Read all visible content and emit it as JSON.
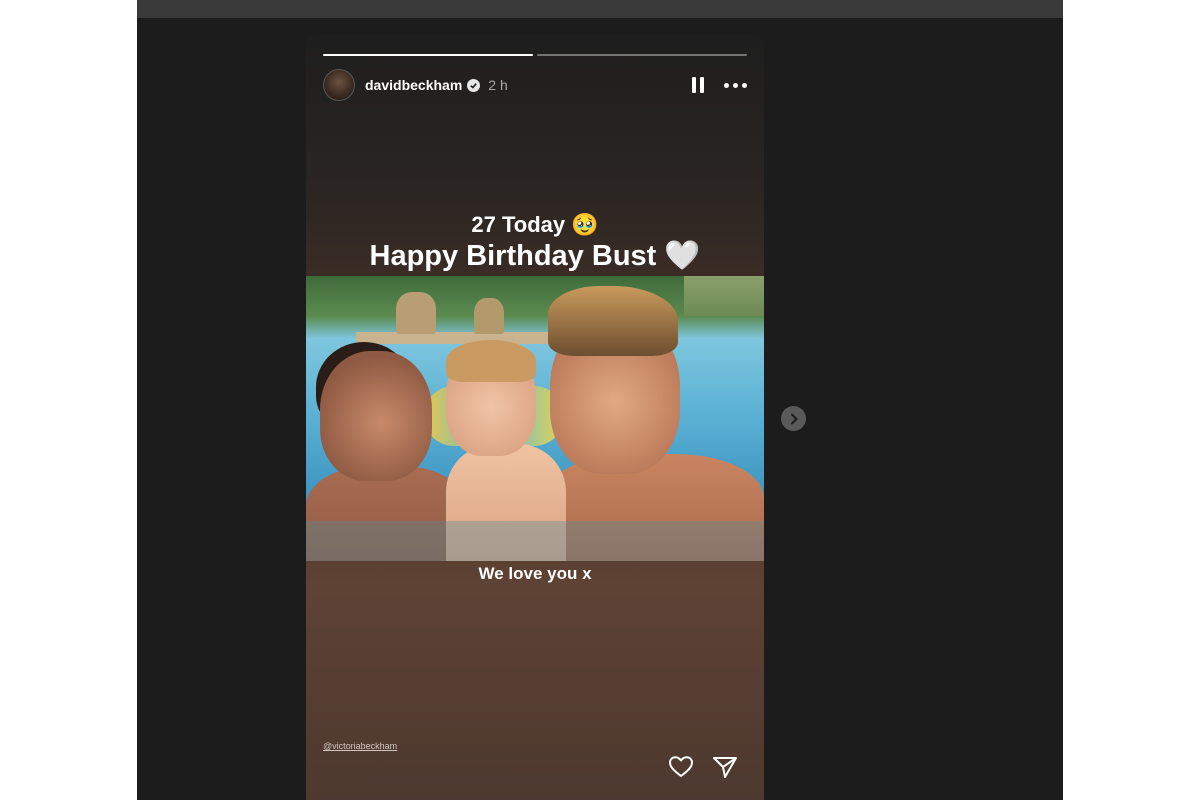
{
  "story": {
    "username": "davidbeckham",
    "time": "2 h",
    "verified": true,
    "progress": [
      1.0,
      0.0
    ],
    "progress_current_fraction": 0.0,
    "line1": "27 Today 🥹",
    "line2": "Happy Birthday Bust 🤍",
    "caption": "We love you x",
    "mention": "@victoriabeckham"
  },
  "icons": {
    "pause": "pause-icon",
    "more": "more-icon",
    "like": "heart-icon",
    "share": "send-icon",
    "next": "chevron-right-icon"
  },
  "colors": {
    "viewer_bg": "#1c1c1c",
    "topbar": "#3a3a3a",
    "text": "#ffffff"
  }
}
